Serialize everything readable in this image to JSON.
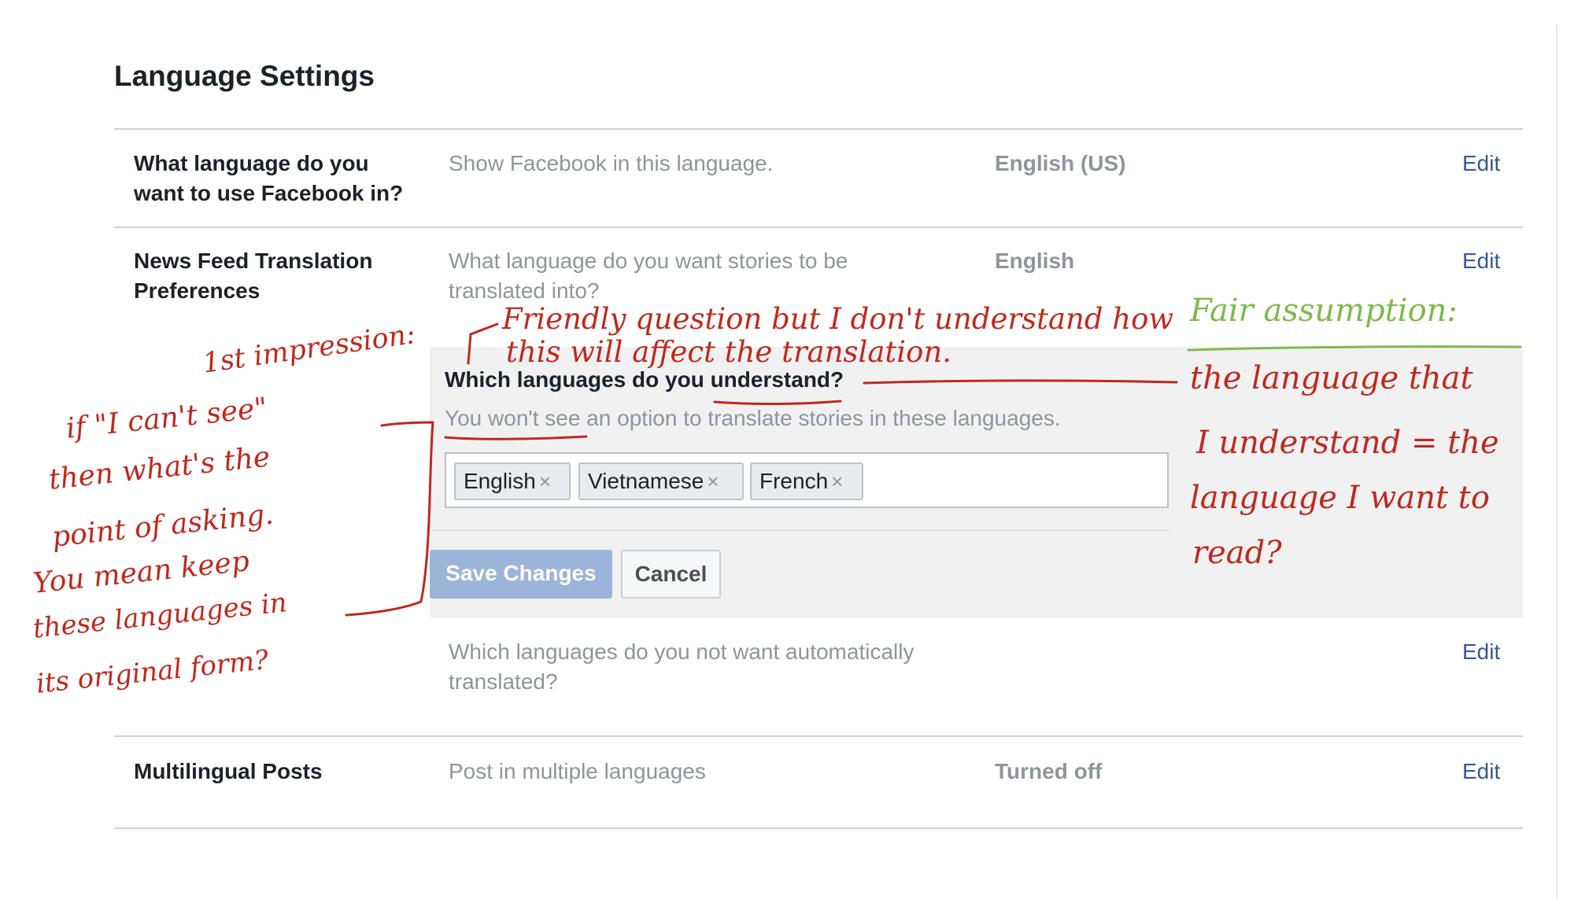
{
  "page": {
    "title": "Language Settings"
  },
  "rows": [
    {
      "label_line1": "What language do you",
      "label_line2": "want to use Facebook in?",
      "description": "Show Facebook in this language.",
      "value": "English (US)",
      "action": "Edit"
    },
    {
      "label_line1": "News Feed Translation",
      "label_line2": "Preferences",
      "description_line1": "What language do you want stories to be",
      "description_line2": "translated into?",
      "value": "English",
      "action": "Edit"
    },
    {
      "description_line1": "Which languages do you not want automatically",
      "description_line2": "translated?",
      "action": "Edit"
    },
    {
      "label_line1": "Multilingual Posts",
      "description": "Post in multiple languages",
      "value": "Turned off",
      "action": "Edit"
    }
  ],
  "edit_panel": {
    "question": "Which languages do you understand?",
    "note": "You won't see an option to translate stories in these languages.",
    "tokens": [
      "English",
      "Vietnamese",
      "French"
    ],
    "token_remove_glyph": "×",
    "save_label": "Save Changes",
    "cancel_label": "Cancel"
  },
  "annotations": {
    "top_note_line1": "Friendly question but I don't understand how",
    "top_note_line2": "this will affect the translation.",
    "first_impression": "1st impression:",
    "left_note": [
      "if \"I can't see\"",
      "then what's the",
      "point of asking.",
      "You mean keep",
      "these languages in",
      "its original form?"
    ],
    "right_heading": "Fair assumption:",
    "right_note": [
      "the language that",
      "I understand = the",
      "language I want to",
      "read?"
    ]
  },
  "colors": {
    "link": "#365899",
    "annotation_red": "#c0281d",
    "annotation_green": "#7dba4a",
    "save_button_disabled": "#9cb4d8",
    "panel_bg": "#f1f1f2"
  }
}
